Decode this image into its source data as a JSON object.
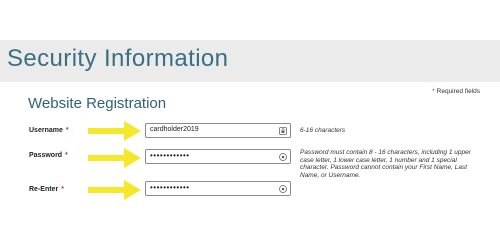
{
  "page": {
    "title": "Security Information"
  },
  "form": {
    "section_title": "Website Registration",
    "required_note": {
      "star": "*",
      "text": "Required fields"
    },
    "fields": [
      {
        "label": "Username",
        "required_star": "*",
        "value": "cardholder2019",
        "icon": "password-manager-icon",
        "hint": "6-16 characters"
      },
      {
        "label": "Password",
        "required_star": "*",
        "value": "••••••••••••",
        "icon": "password-manager-icon",
        "hint": "Password must contain 8 - 16 characters, including 1 upper case letter, 1 lower case letter, 1 number and 1 special character. Password cannot contain your First Name, Last Name, or Username."
      },
      {
        "label": "Re-Enter",
        "required_star": "*",
        "value": "••••••••••••",
        "icon": "password-manager-icon",
        "hint": ""
      }
    ]
  },
  "colors": {
    "title": "#3a6f84",
    "section_title": "#2f6178",
    "header_band": "#ebebeb",
    "required_star": "#c0392b",
    "arrow": "#f5e72a"
  }
}
